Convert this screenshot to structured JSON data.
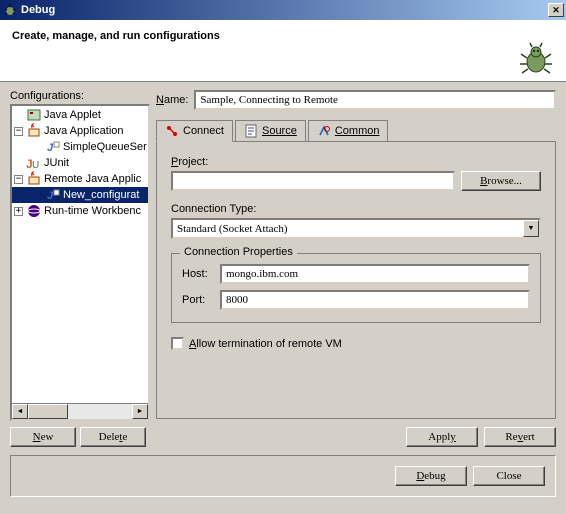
{
  "titlebar": {
    "title": "Debug"
  },
  "header": {
    "title": "Create, manage, and run configurations"
  },
  "configurations": {
    "label": "Configurations:",
    "items": [
      {
        "label": "Java Applet"
      },
      {
        "label": "Java Application"
      },
      {
        "label": "SimpleQueueSer"
      },
      {
        "label": "JUnit"
      },
      {
        "label": "Remote Java Applic"
      },
      {
        "label": "New_configurat"
      },
      {
        "label": "Run-time Workbenc"
      }
    ],
    "buttons": {
      "new": "New",
      "delete": "Delete"
    }
  },
  "name": {
    "label": "Name:",
    "value": "Sample, Connecting to Remote"
  },
  "tabs": {
    "connect": "Connect",
    "source": "Source",
    "common": "Common"
  },
  "connect": {
    "project_label": "Project:",
    "project_value": "",
    "browse": "Browse...",
    "conn_type_label": "Connection Type:",
    "conn_type_value": "Standard (Socket Attach)",
    "properties_legend": "Connection Properties",
    "host_label": "Host:",
    "host_value": "mongo.ibm.com",
    "port_label": "Port:",
    "port_value": "8000",
    "allow_terminate": "Allow termination of remote VM"
  },
  "buttons": {
    "apply": "Apply",
    "revert": "Revert",
    "debug": "Debug",
    "close": "Close"
  }
}
